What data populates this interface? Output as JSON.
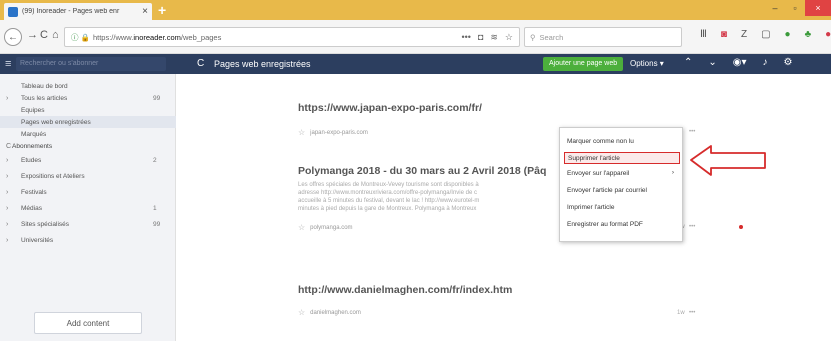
{
  "browser": {
    "tab_title": "(99) Inoreader - Pages web enr",
    "tab_close": "×",
    "new_tab": "+",
    "win_minimize": "–",
    "win_maximize": "▫",
    "win_close": "×",
    "url_prefix": "https://www.",
    "url_host": "inoreader.com",
    "url_path": "/web_pages",
    "search_placeholder": "Search",
    "toolbar_icons": [
      "library-icon",
      "pocket-icon",
      "z-icon",
      "reader-icon",
      "leaf-icon",
      "notification-badge-icon",
      "extension-icon"
    ]
  },
  "app": {
    "search_placeholder": "Rechercher ou s'abonner",
    "page_title": "Pages web enregistrées",
    "add_web_page": "Ajouter une page web",
    "options": "Options"
  },
  "sidebar": {
    "items": [
      {
        "label": "Tableau de bord",
        "count": "",
        "chevron": ""
      },
      {
        "label": "Tous les articles",
        "count": "99",
        "chevron": "›"
      },
      {
        "label": "Equipes",
        "count": "",
        "chevron": ""
      },
      {
        "label": "Pages web enregistrées",
        "count": "",
        "chevron": ""
      },
      {
        "label": "Marqués",
        "count": "",
        "chevron": ""
      }
    ],
    "section_label": "Abonnements",
    "section_icon": "C",
    "folders": [
      {
        "label": "Etudes",
        "count": "2"
      },
      {
        "label": "Expositions et Ateliers",
        "count": ""
      },
      {
        "label": "Festivals",
        "count": ""
      },
      {
        "label": "Médias",
        "count": "1"
      },
      {
        "label": "Sites spécialisés",
        "count": "99"
      },
      {
        "label": "Universités",
        "count": ""
      }
    ],
    "folder_chevron": "›",
    "add_content": "Add content"
  },
  "articles": [
    {
      "title": "https://www.japan-expo-paris.com/fr/",
      "source": "japan-expo-paris.com",
      "time": "1w",
      "more": "•••"
    },
    {
      "title": "Polymanga 2018 - du 30 mars au 2 Avril 2018 (Pâq",
      "source": "polymanga.com",
      "body": [
        "Les offres spéciales de Montreux-Vevey tourisme sont disponibles à",
        "adresse http://www.montreuxriviera.com/offre-polymanga/Invie de c                                                              nous",
        "accueille à 5 minutes du festival, devant le lac ! http://www.eurotel-m                                                         e à 5",
        "minutes à pied depuis la gare de Montreux. Polymanga à Montreux                                                                 et un"
      ],
      "time": "1w",
      "more": "•••"
    },
    {
      "title": "http://www.danielmaghen.com/fr/index.htm",
      "source": "danielmaghen.com",
      "time": "1w",
      "more": "•••"
    }
  ],
  "context_menu": {
    "items": [
      {
        "label": "Marquer comme non lu",
        "submenu": ""
      },
      {
        "label": "Supprimer l'article",
        "submenu": ""
      },
      {
        "label": "Envoyer sur l'appareil",
        "submenu": "›"
      },
      {
        "label": "Envoyer l'article par courriel",
        "submenu": ""
      },
      {
        "label": "Imprimer l'article",
        "submenu": ""
      },
      {
        "label": "Enregistrer au format PDF",
        "submenu": ""
      }
    ],
    "highlighted_index": 1
  },
  "colors": {
    "tab_strip": "#e8b94a",
    "app_header": "#2c3e5f",
    "add_button": "#4caf3c",
    "highlight_red": "#d62b2b"
  }
}
